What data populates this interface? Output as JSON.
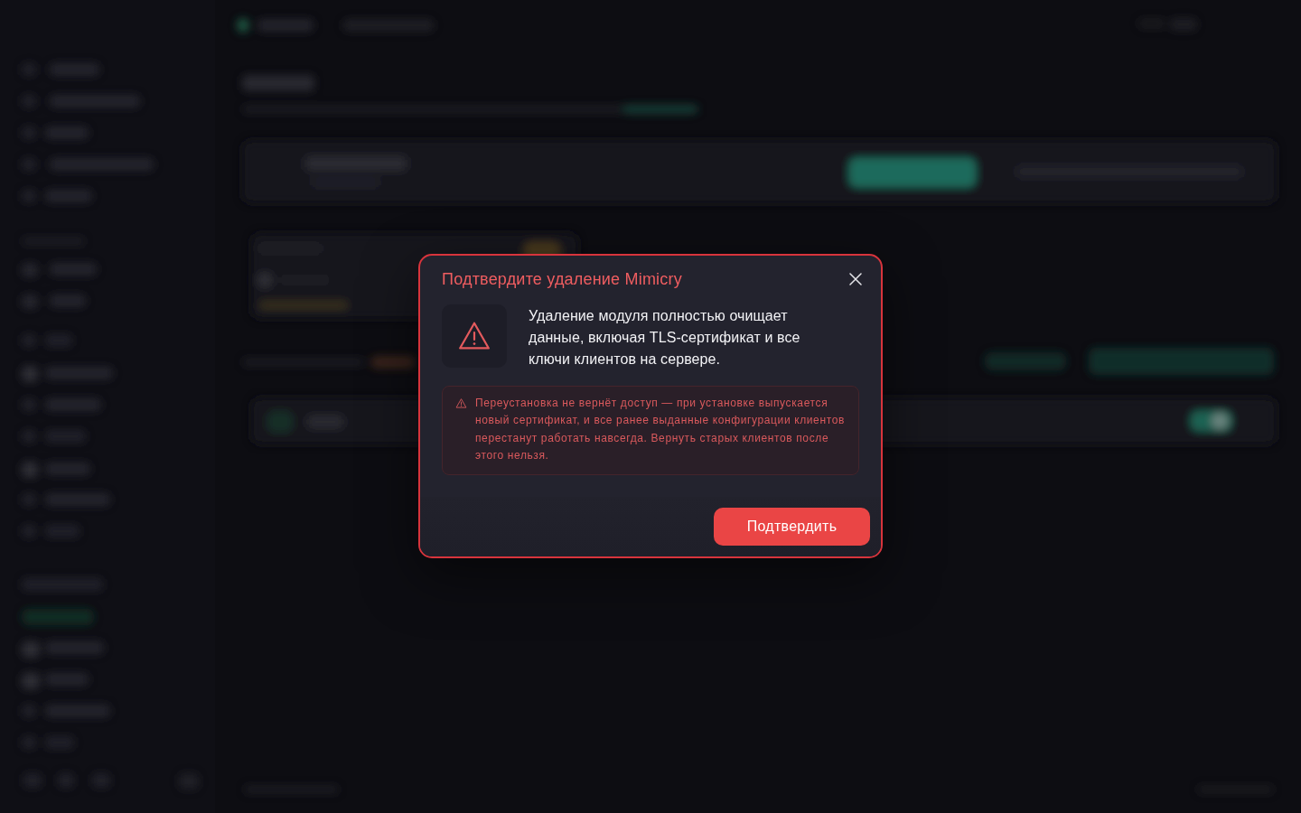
{
  "dialog": {
    "title": "Подтвердите удаление Mimicry",
    "message": "Удаление модуля полностью очищает данные, включая TLS-сертификат и все ключи клиентов на сервере.",
    "warning": "Переустановка не вернёт доступ — при установке выпускается новый сертификат, и все ранее выданные конфигурации клиентов перестанут работать навсегда. Вернуть старых клиентов после этого нельзя.",
    "confirm_button": "Подтвердить"
  }
}
